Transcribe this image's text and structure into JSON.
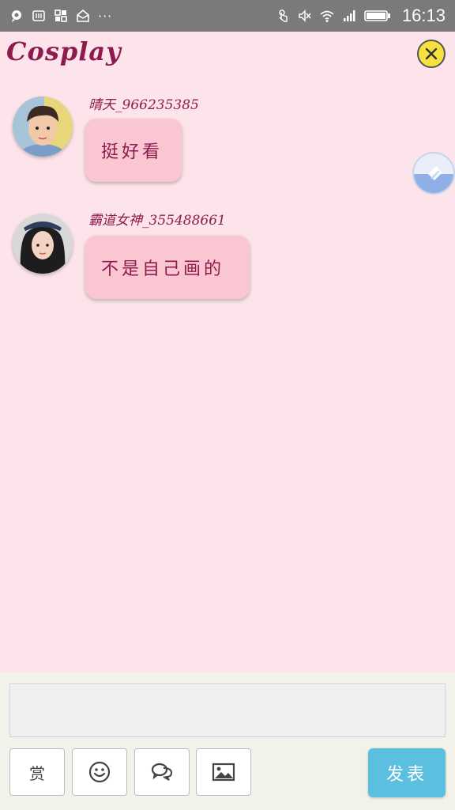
{
  "status_bar": {
    "left_icons": [
      "chat-bubble-icon",
      "sim-card-icon",
      "apps-grid-icon",
      "mail-icon"
    ],
    "overflow": "···",
    "right_icons": [
      "touch-icon",
      "mute-icon",
      "wifi-icon",
      "signal-icon",
      "battery-icon"
    ],
    "time": "16:13"
  },
  "header": {
    "title": "Cosplay",
    "close_icon": "close-icon",
    "accent_color": "#8e1b4d"
  },
  "messages": [
    {
      "username": "晴天_966235385",
      "text": "挺好看",
      "avatar": "avatar-boy"
    },
    {
      "username": "霸道女神_355488661",
      "text": "不是自己画的",
      "avatar": "avatar-girl"
    }
  ],
  "composer": {
    "input_value": "",
    "input_placeholder": "",
    "reward_label": "赏",
    "tools": [
      "emoji-icon",
      "comment-icon",
      "image-icon"
    ],
    "send_label": "发表",
    "send_color": "#5bbfe0"
  }
}
